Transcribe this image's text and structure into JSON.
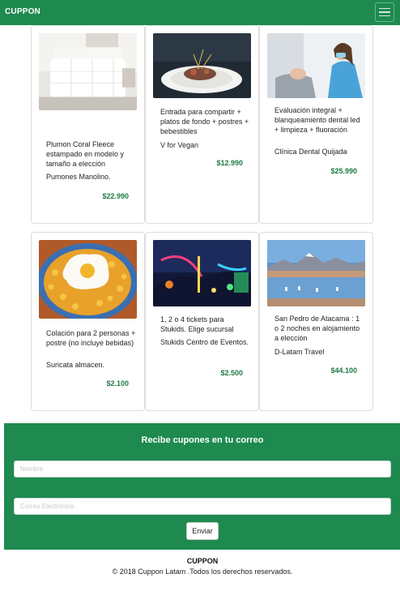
{
  "header": {
    "brand": "CUPPON",
    "menu_icon": "hamburger-menu-icon"
  },
  "products": [
    {
      "title": "Plumon Coral Fleece estampado en modelo y tamaño a elección",
      "vendor": "Pumones Manolino.",
      "price": "$22.990",
      "image": "white-bed-comforter"
    },
    {
      "title": "Entrada para compartir + platos de fondo + postres + bebestibles",
      "vendor": "V for Vegan",
      "price": "$12.990",
      "image": "plated-gourmet-dish"
    },
    {
      "title": "Evaluación integral + blanqueamiento dental led + limpieza + fluoración",
      "vendor": "Clínica Dental Quijada",
      "price": "$25.990",
      "image": "dentist-with-patient"
    },
    {
      "title": "Colación para 2 personas + postre (no incluye bebidas)",
      "vendor": "Suricata almacen.",
      "price": "$2.100",
      "image": "fried-egg-with-corn"
    },
    {
      "title": "1, 2 o 4 tickets para Stukids. Elige sucursal",
      "vendor": "Stukids Centro de Eventos.",
      "price": "$2.500",
      "image": "amusement-park-night-lights"
    },
    {
      "title": "San Pedro de Atacama : 1 o 2 noches en alojamiento a elección",
      "vendor": "D-Latam Travel",
      "price": "$44.100",
      "image": "atacama-lagoon-with-flamingos"
    }
  ],
  "newsletter": {
    "title": "Recibe cupones en tu correo",
    "name_placeholder": "Nombre",
    "email_placeholder": "Correo Electrónico",
    "submit_label": "Enviar"
  },
  "footer": {
    "brand": "CUPPON",
    "copyright": "© 2018 Cuppon Latam .Todos los derechos reservados."
  },
  "colors": {
    "brand_green": "#1e8a4f",
    "price_green": "#1e7a45"
  }
}
